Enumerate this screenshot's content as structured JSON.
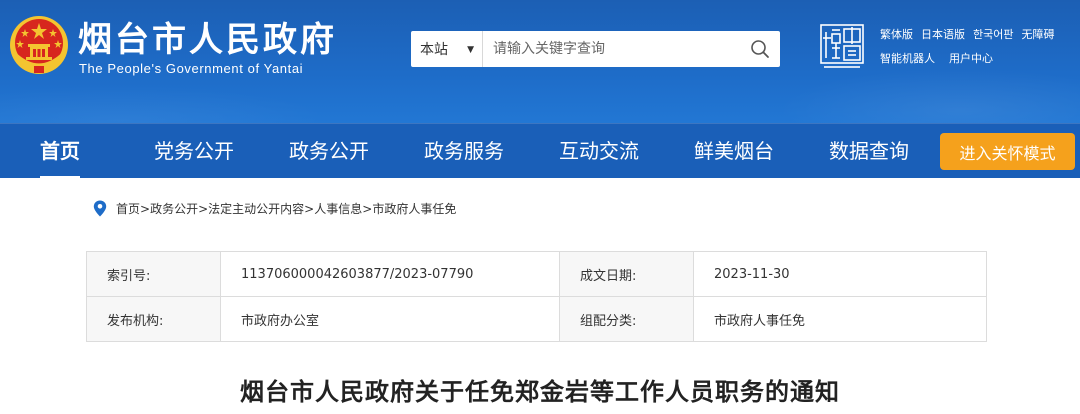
{
  "header": {
    "title": "烟台市人民政府",
    "subtitle": "The People's Government of Yantai",
    "search": {
      "scope": "本站",
      "placeholder": "请输入关键字查询"
    },
    "top_links": [
      "繁体版",
      "日本语版",
      "한국어판",
      "无障碍",
      "智能机器人",
      "用户中心"
    ]
  },
  "nav": {
    "items": [
      "首页",
      "党务公开",
      "政务公开",
      "政务服务",
      "互动交流",
      "鲜美烟台",
      "数据查询"
    ],
    "active_index": 0,
    "care_mode": "进入关怀模式"
  },
  "breadcrumb": [
    "首页",
    "政务公开",
    "法定主动公开内容",
    "人事信息",
    "市政府人事任免"
  ],
  "meta": {
    "index_no_label": "索引号:",
    "index_no": "113706000042603877/2023-07790",
    "date_label": "成文日期:",
    "date": "2023-11-30",
    "publisher_label": "发布机构:",
    "publisher": "市政府办公室",
    "category_label": "组配分类:",
    "category": "市政府人事任免"
  },
  "article": {
    "title": "烟台市人民政府关于任免郑金岩等工作人员职务的通知"
  },
  "colors": {
    "header_blue": "#1e6cc8",
    "nav_blue": "#1a5fb8",
    "care_orange": "#f5a11c",
    "emblem_red": "#d7261e",
    "emblem_gold": "#f4c430"
  },
  "icons": {
    "emblem": "national-emblem-icon",
    "search": "search-icon",
    "caret": "caret-down-icon",
    "pin": "location-pin-icon",
    "badge": "yantai-china-logo-icon"
  }
}
